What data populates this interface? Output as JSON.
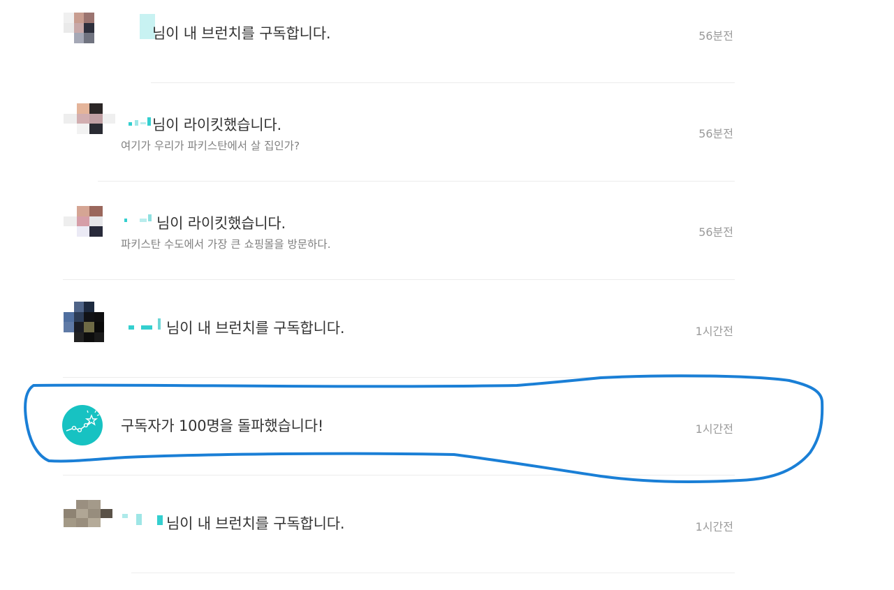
{
  "notifications": [
    {
      "type": "subscribe",
      "message": "님이 내 브런치를 구독합니다.",
      "time": "56분전",
      "subtext": ""
    },
    {
      "type": "like",
      "message": "님이 라이킷했습니다.",
      "time": "56분전",
      "subtext": "여기가 우리가 파키스탄에서 살 집인가?"
    },
    {
      "type": "like",
      "message": "님이 라이킷했습니다.",
      "time": "56분전",
      "subtext": "파키스탄 수도에서 가장 큰 쇼핑몰을 방문하다."
    },
    {
      "type": "subscribe",
      "message": "님이 내 브런치를 구독합니다.",
      "time": "1시간전",
      "subtext": ""
    },
    {
      "type": "milestone",
      "message": "구독자가 100명을 돌파했습니다!",
      "time": "1시간전",
      "subtext": "",
      "icon": "growth-chart-star-icon"
    },
    {
      "type": "subscribe",
      "message": "님이 내 브런치를 구독합니다.",
      "time": "1시간전",
      "subtext": ""
    }
  ],
  "colors": {
    "accent": "#17c2c2",
    "highlight_stroke": "#1a7fd6",
    "divider": "#ececec"
  }
}
